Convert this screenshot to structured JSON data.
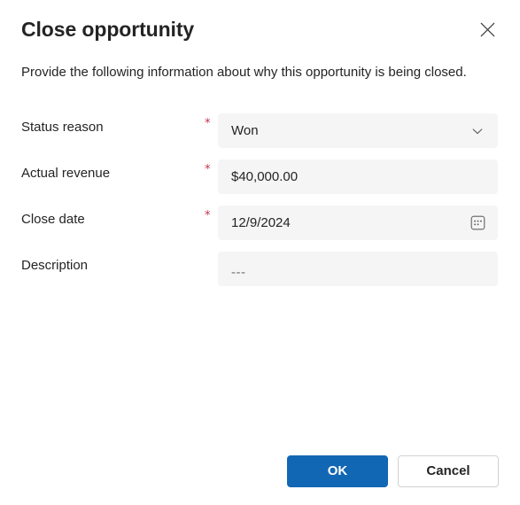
{
  "dialog": {
    "title": "Close opportunity",
    "subtitle": "Provide the following information about why this opportunity is being closed.",
    "close_icon": "close-icon",
    "accent_color": "#1267b4",
    "field_background": "#f5f5f5",
    "required_marker": "*",
    "required_marker_color": "#c4314b"
  },
  "form": {
    "fields": [
      {
        "label": "Status reason",
        "required": "*",
        "value": "Won",
        "type": "dropdown",
        "icon": "chevron-down-icon"
      },
      {
        "label": "Actual revenue",
        "required": "*",
        "value": "$40,000.00",
        "type": "text",
        "icon": ""
      },
      {
        "label": "Close date",
        "required": "*",
        "value": "12/9/2024",
        "type": "date",
        "icon": "calendar-icon"
      },
      {
        "label": "Description",
        "required": "",
        "value": "---",
        "type": "text",
        "icon": ""
      }
    ]
  },
  "footer": {
    "ok_label": "OK",
    "cancel_label": "Cancel"
  }
}
